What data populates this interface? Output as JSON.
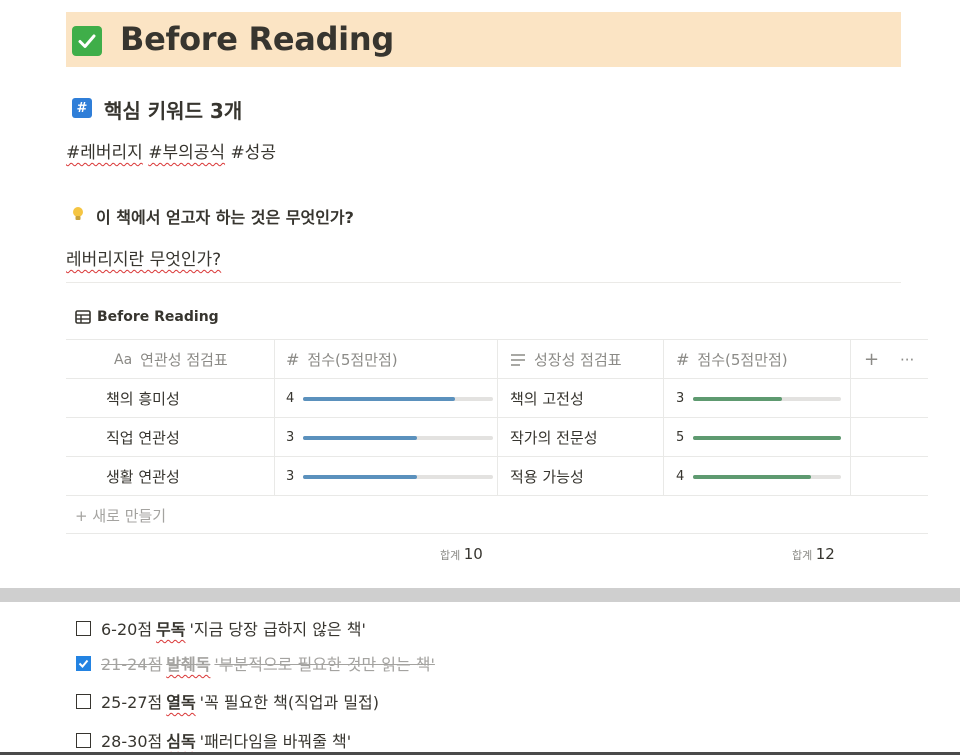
{
  "page": {
    "title": "Before Reading",
    "keywords_heading": "핵심 키워드 3개",
    "tags": [
      "#레버리지",
      "#부의공식",
      "#성공"
    ],
    "question": "이 책에서 얻고자 하는 것은 무엇인가?",
    "answer": "레버리지란 무엇인가?"
  },
  "table": {
    "title": "Before Reading",
    "headers": {
      "c1": "연관성 점검표",
      "c1_prefix": "Aa",
      "c2": "점수(5점만점)",
      "c3": "성장성 점검표",
      "c4": "점수(5점만점)",
      "add": "+",
      "more": "···"
    },
    "rows": [
      {
        "name1": "책의 흥미성",
        "score1": 4,
        "name2": "책의 고전성",
        "score2": 3
      },
      {
        "name1": "직업 연관성",
        "score1": 3,
        "name2": "작가의 전문성",
        "score2": 5
      },
      {
        "name1": "생활 연관성",
        "score1": 3,
        "name2": "적용 가능성",
        "score2": 4
      }
    ],
    "max_score": 5,
    "new_row": "+ 새로 만들기",
    "sum_label": "합계",
    "sum1": "10",
    "sum2": "12",
    "colors": {
      "bar1": "#5b91bd",
      "bar2": "#5e9a70",
      "track": "#e3e2e0"
    }
  },
  "checklist": [
    {
      "checked": false,
      "range": "6-20점",
      "type": "무독",
      "desc": "'지금 당장 급하지 않은 책'"
    },
    {
      "checked": true,
      "range": "21-24점",
      "type": "발췌독",
      "desc": "'부분적으로 필요한 것만 읽는 책'"
    },
    {
      "checked": false,
      "range": "25-27점",
      "type": "열독",
      "desc": "'꼭 필요한 책(직업과 밀접)"
    },
    {
      "checked": false,
      "range": "28-30점",
      "type": "심독",
      "desc": "'패러다임을 바꿔줄 책'"
    }
  ]
}
